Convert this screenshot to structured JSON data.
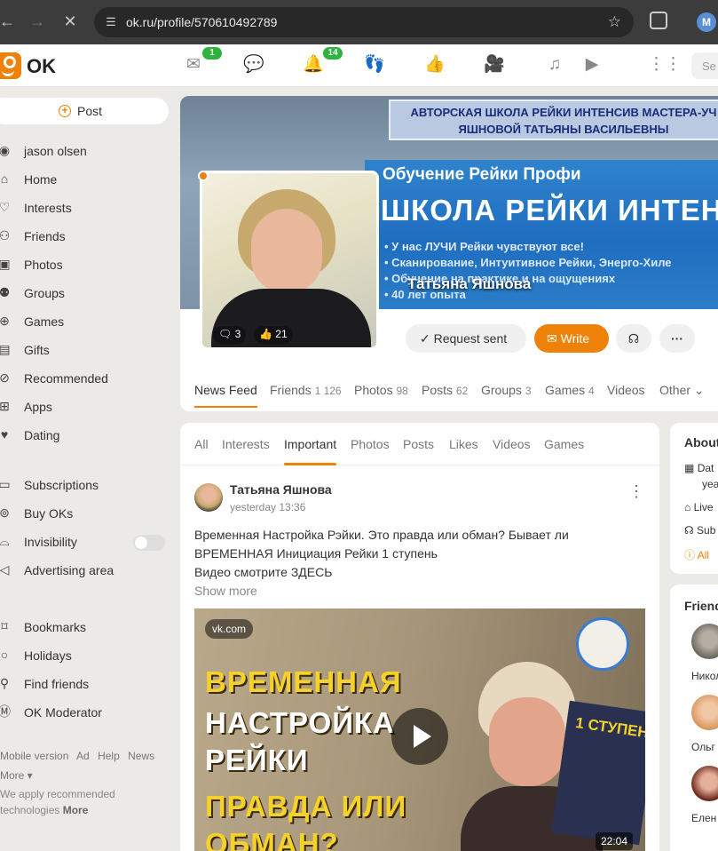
{
  "browser": {
    "url": "ok.ru/profile/570610492789",
    "profile_initial": "M"
  },
  "header": {
    "logo_text": "OK",
    "badges": {
      "messages": "1",
      "notifications": "14"
    },
    "search_placeholder": "Se"
  },
  "sidebar": {
    "post_label": "Post",
    "items": [
      {
        "label": "jason olsen",
        "icon": "user-circle-icon"
      },
      {
        "label": "Home",
        "icon": "home-icon"
      },
      {
        "label": "Interests",
        "icon": "interests-icon"
      },
      {
        "label": "Friends",
        "icon": "friends-icon"
      },
      {
        "label": "Photos",
        "icon": "photos-icon"
      },
      {
        "label": "Groups",
        "icon": "groups-icon"
      },
      {
        "label": "Games",
        "icon": "games-icon"
      },
      {
        "label": "Gifts",
        "icon": "gift-icon"
      },
      {
        "label": "Recommended",
        "icon": "compass-icon"
      },
      {
        "label": "Apps",
        "icon": "apps-icon"
      },
      {
        "label": "Dating",
        "icon": "dating-icon"
      },
      {
        "label": "Subscriptions",
        "icon": "wallet-icon"
      },
      {
        "label": "Buy OKs",
        "icon": "coins-icon"
      },
      {
        "label": "Invisibility",
        "icon": "hat-icon"
      },
      {
        "label": "Advertising area",
        "icon": "megaphone-icon"
      },
      {
        "label": "Bookmarks",
        "icon": "bookmark-icon"
      },
      {
        "label": "Holidays",
        "icon": "balloon-icon"
      },
      {
        "label": "Find friends",
        "icon": "add-friend-icon"
      },
      {
        "label": "OK Moderator",
        "icon": "moderator-icon"
      }
    ],
    "footer_links": [
      "Mobile version",
      "Ad",
      "Help",
      "News",
      "More ▾"
    ],
    "footer_note": "We apply recommended technologies",
    "footer_note_more": "More"
  },
  "profile": {
    "name": "Татьяна Яшнова",
    "banner_line1": "АВТОРСКАЯ ШКОЛА РЕЙКИ ИНТЕНСИВ МАСТЕРА-УЧ",
    "banner_line2": "ЯШНОВОЙ ТАТЬЯНЫ ВАСИЛЬЕВНЫ",
    "banner_title": "Обучение Рейки Профи",
    "banner_big": "ШКОЛА РЕЙКИ ИНТЕНС",
    "banner_bullets": [
      "• У нас ЛУЧИ Рейки чувствуют все!",
      "• Сканирование, Интуитивное Рейки, Энерго-Хиле",
      "• Обучение на практике и на ощущениях",
      "• 40 лет опыта"
    ],
    "photo_comments": "3",
    "photo_likes": "21",
    "buttons": {
      "request": "Request sent",
      "write": "Write"
    },
    "tabs": [
      {
        "label": "News Feed",
        "count": ""
      },
      {
        "label": "Friends",
        "count": "1 126"
      },
      {
        "label": "Photos",
        "count": "98"
      },
      {
        "label": "Posts",
        "count": "62"
      },
      {
        "label": "Groups",
        "count": "3"
      },
      {
        "label": "Games",
        "count": "4"
      },
      {
        "label": "Videos",
        "count": ""
      },
      {
        "label": "Other",
        "count": ""
      }
    ]
  },
  "feed": {
    "filters": [
      "All",
      "Interests",
      "Important",
      "Photos",
      "Posts",
      "Likes",
      "Videos",
      "Games"
    ],
    "active_filter": "Important",
    "post": {
      "author": "Татьяна Яшнова",
      "time": "yesterday 13:36",
      "text_line1": "Временная Настройка Рэйки. Это правда или обман? Бывает ли",
      "text_line2": "ВРЕМЕННАЯ Инициация Рейки 1 ступень",
      "text_line3": "Видео смотрите ЗДЕСЬ",
      "show_more": "Show more",
      "video": {
        "source": "vk.com",
        "title_lines": [
          "ВРЕМЕННАЯ",
          "НАСТРОЙКА",
          "РЕЙКИ",
          "ПРАВДА ИЛИ",
          "ОБМАН?"
        ],
        "book_text": "1 СТУПЕН",
        "duration": "22:04"
      }
    }
  },
  "about": {
    "title": "About",
    "rows": [
      "Dat",
      "yea",
      "Live",
      "Sub",
      "All"
    ]
  },
  "friends": {
    "title": "Friend",
    "names": [
      "Никол",
      "Ольг",
      "Елен"
    ]
  }
}
